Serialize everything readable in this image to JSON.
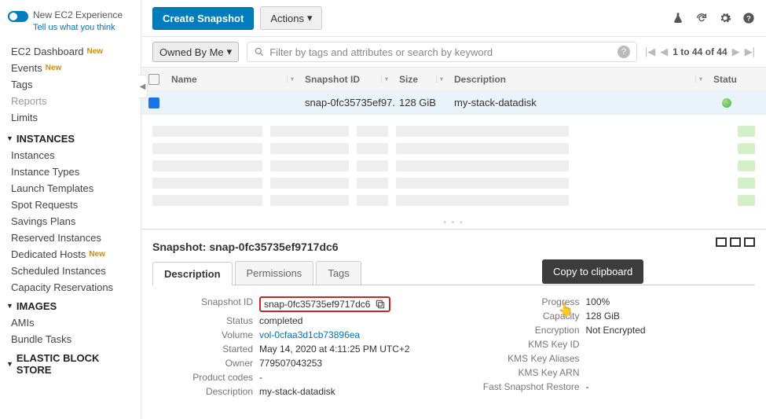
{
  "sidebar": {
    "new_experience": {
      "title": "New EC2 Experience",
      "feedback": "Tell us what you think"
    },
    "items_top": [
      {
        "label": "EC2 Dashboard",
        "new": true
      },
      {
        "label": "Events",
        "new": true
      },
      {
        "label": "Tags",
        "new": false
      },
      {
        "label": "Reports",
        "new": false,
        "muted": true
      },
      {
        "label": "Limits",
        "new": false
      }
    ],
    "sections": [
      {
        "header": "INSTANCES",
        "items": [
          "Instances",
          "Instance Types",
          "Launch Templates",
          "Spot Requests",
          "Savings Plans",
          "Reserved Instances",
          "Dedicated Hosts",
          "Scheduled Instances",
          "Capacity Reservations"
        ],
        "new_flags": [
          false,
          false,
          false,
          false,
          false,
          false,
          true,
          false,
          false
        ]
      },
      {
        "header": "IMAGES",
        "items": [
          "AMIs",
          "Bundle Tasks"
        ],
        "new_flags": [
          false,
          false
        ]
      },
      {
        "header": "ELASTIC BLOCK STORE",
        "items": [],
        "new_flags": []
      }
    ]
  },
  "toolbar": {
    "create": "Create Snapshot",
    "actions": "Actions"
  },
  "filter": {
    "owned": "Owned By Me",
    "placeholder": "Filter by tags and attributes or search by keyword",
    "pager": "1 to 44 of 44"
  },
  "table": {
    "columns": [
      "Name",
      "Snapshot ID",
      "Size",
      "Description",
      "Statu"
    ],
    "row": {
      "name": "",
      "snapshot_id": "snap-0fc35735ef97...",
      "size": "128 GiB",
      "description": "my-stack-datadisk"
    }
  },
  "details": {
    "title_prefix": "Snapshot: ",
    "title_id": "snap-0fc35735ef9717dc6",
    "tabs": [
      "Description",
      "Permissions",
      "Tags"
    ],
    "tooltip": "Copy to clipboard",
    "left": {
      "snapshot_id_label": "Snapshot ID",
      "snapshot_id": "snap-0fc35735ef9717dc6",
      "status_label": "Status",
      "status": "completed",
      "volume_label": "Volume",
      "volume": "vol-0cfaa3d1cb73896ea",
      "started_label": "Started",
      "started": "May 14, 2020 at 4:11:25 PM UTC+2",
      "owner_label": "Owner",
      "owner": "779507043253",
      "product_label": "Product codes",
      "product": "-",
      "description_label": "Description",
      "description": "my-stack-datadisk"
    },
    "right": {
      "progress_label": "Progress",
      "progress": "100%",
      "capacity_label": "Capacity",
      "capacity": "128 GiB",
      "encryption_label": "Encryption",
      "encryption": "Not Encrypted",
      "kmskeyid_label": "KMS Key ID",
      "kmskeyid": "",
      "kmsalias_label": "KMS Key Aliases",
      "kmsalias": "",
      "kmsarn_label": "KMS Key ARN",
      "kmsarn": "",
      "fastrestore_label": "Fast Snapshot Restore",
      "fastrestore": "-"
    }
  }
}
